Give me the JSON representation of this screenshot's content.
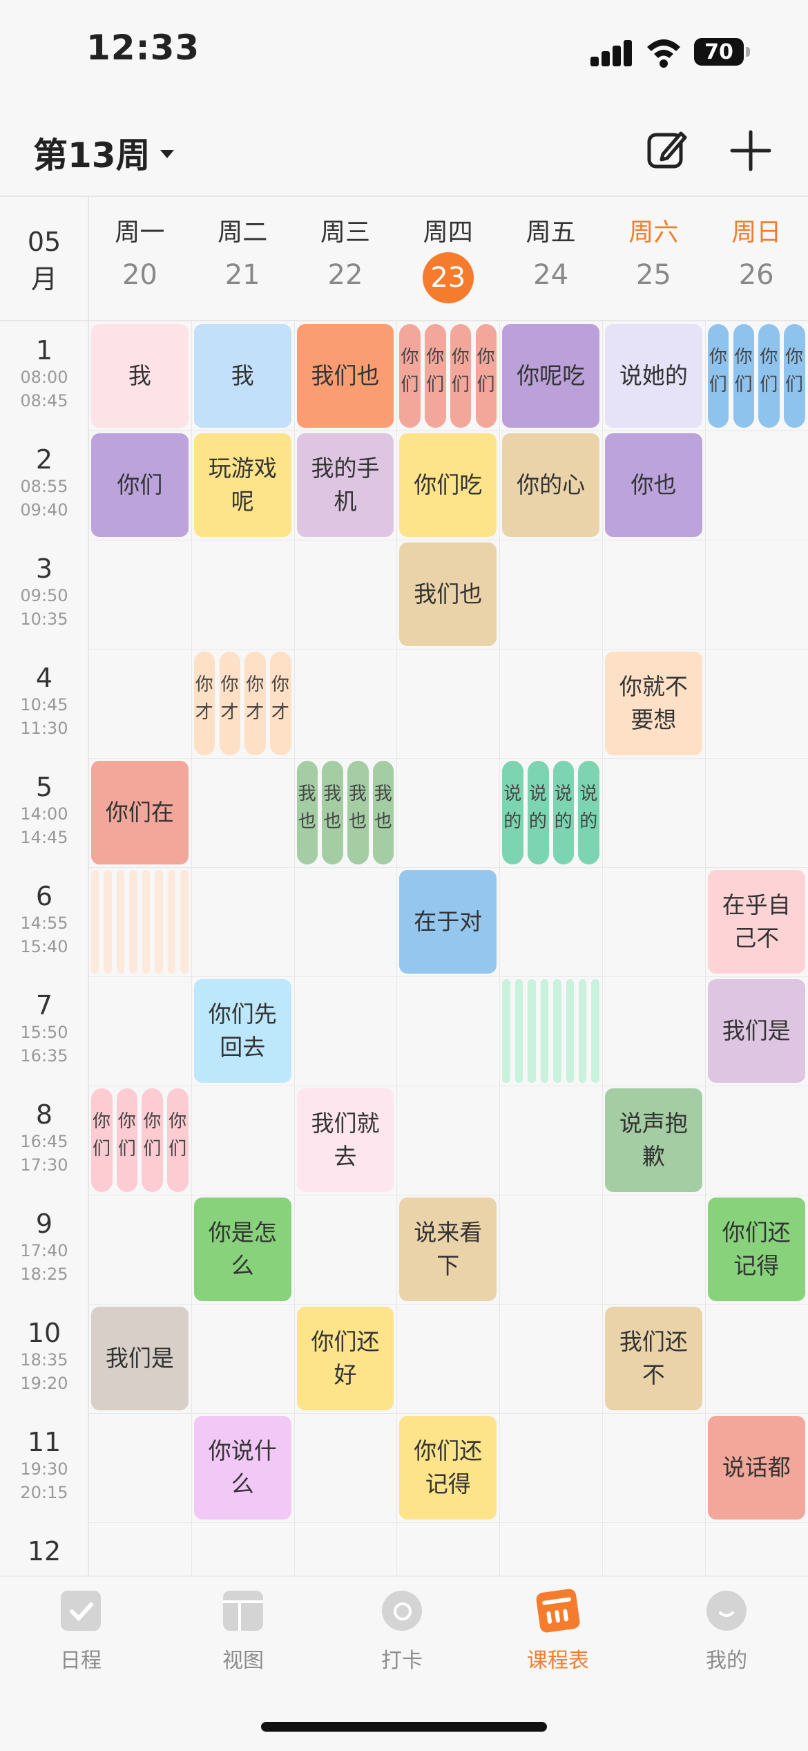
{
  "status": {
    "time": "12:33",
    "battery": "70"
  },
  "header": {
    "week_label": "第13周"
  },
  "month": {
    "line1": "05",
    "line2": "月"
  },
  "colors": {
    "accent": "#f47c2c"
  },
  "days": [
    {
      "name": "周一",
      "date": "20"
    },
    {
      "name": "周二",
      "date": "21"
    },
    {
      "name": "周三",
      "date": "22"
    },
    {
      "name": "周四",
      "date": "23",
      "today": true
    },
    {
      "name": "周五",
      "date": "24"
    },
    {
      "name": "周六",
      "date": "25",
      "weekend": true
    },
    {
      "name": "周日",
      "date": "26",
      "weekend": true
    }
  ],
  "periods": [
    {
      "n": "1",
      "start": "08:00",
      "end": "08:45"
    },
    {
      "n": "2",
      "start": "08:55",
      "end": "09:40"
    },
    {
      "n": "3",
      "start": "09:50",
      "end": "10:35"
    },
    {
      "n": "4",
      "start": "10:45",
      "end": "11:30"
    },
    {
      "n": "5",
      "start": "14:00",
      "end": "14:45"
    },
    {
      "n": "6",
      "start": "14:55",
      "end": "15:40"
    },
    {
      "n": "7",
      "start": "15:50",
      "end": "16:35"
    },
    {
      "n": "8",
      "start": "16:45",
      "end": "17:30"
    },
    {
      "n": "9",
      "start": "17:40",
      "end": "18:25"
    },
    {
      "n": "10",
      "start": "18:35",
      "end": "19:20"
    },
    {
      "n": "11",
      "start": "19:30",
      "end": "20:15"
    },
    {
      "n": "12",
      "start": "",
      "end": ""
    }
  ],
  "courses": [
    {
      "day": 0,
      "period": 0,
      "text": "我",
      "color": "#fde3e8"
    },
    {
      "day": 1,
      "period": 0,
      "text": "我",
      "color": "#c3e0fb"
    },
    {
      "day": 2,
      "period": 0,
      "text": "我们也",
      "color": "#fb9d72"
    },
    {
      "day": 4,
      "period": 0,
      "text": "你呢吃",
      "color": "#bba0da"
    },
    {
      "day": 5,
      "period": 0,
      "text": "说她的",
      "color": "#e6e2f8"
    },
    {
      "day": 0,
      "period": 1,
      "text": "你们",
      "color": "#bca3dc"
    },
    {
      "day": 1,
      "period": 1,
      "text": "玩游戏呢",
      "color": "#fde48a"
    },
    {
      "day": 2,
      "period": 1,
      "text": "我的手机",
      "color": "#dec6e3"
    },
    {
      "day": 3,
      "period": 1,
      "text": "你们吃",
      "color": "#fde48a"
    },
    {
      "day": 4,
      "period": 1,
      "text": "你的心",
      "color": "#ead3a9"
    },
    {
      "day": 5,
      "period": 1,
      "text": "你也",
      "color": "#bca3dc"
    },
    {
      "day": 3,
      "period": 2,
      "text": "我们也",
      "color": "#ead3a9"
    },
    {
      "day": 5,
      "period": 3,
      "text": "你就不要想",
      "color": "#fde0c6"
    },
    {
      "day": 0,
      "period": 4,
      "text": "你们在",
      "color": "#f2a79a"
    },
    {
      "day": 3,
      "period": 5,
      "text": "在于对",
      "color": "#95c7ee"
    },
    {
      "day": 6,
      "period": 5,
      "text": "在乎自己不",
      "color": "#fdd3d6"
    },
    {
      "day": 1,
      "period": 6,
      "text": "你们先回去",
      "color": "#bde7fb"
    },
    {
      "day": 6,
      "period": 6,
      "text": "我们是",
      "color": "#dec6e3"
    },
    {
      "day": 2,
      "period": 7,
      "text": "我们就去",
      "color": "#fde6ee"
    },
    {
      "day": 5,
      "period": 7,
      "text": "说声抱歉",
      "color": "#a4cda4"
    },
    {
      "day": 1,
      "period": 8,
      "text": "你是怎么",
      "color": "#88d27c"
    },
    {
      "day": 3,
      "period": 8,
      "text": "说来看下",
      "color": "#ead3a9"
    },
    {
      "day": 6,
      "period": 8,
      "text": "你们还记得",
      "color": "#88d27c"
    },
    {
      "day": 0,
      "period": 9,
      "text": "我们是",
      "color": "#d8d0c8"
    },
    {
      "day": 2,
      "period": 9,
      "text": "你们还好",
      "color": "#fde48a"
    },
    {
      "day": 5,
      "period": 9,
      "text": "我们还不",
      "color": "#ead3a9"
    },
    {
      "day": 1,
      "period": 10,
      "text": "你说什么",
      "color": "#f2c9f6"
    },
    {
      "day": 3,
      "period": 10,
      "text": "你们还记得",
      "color": "#fde48a"
    },
    {
      "day": 6,
      "period": 10,
      "text": "说话都",
      "color": "#f2a79a"
    }
  ],
  "strip_groups": [
    {
      "day": 3,
      "period": 0,
      "count": 4,
      "color": "#f2a79a",
      "c1": "你",
      "c2": "们"
    },
    {
      "day": 6,
      "period": 0,
      "count": 4,
      "color": "#8ec3ee",
      "c1": "你",
      "c2": "们"
    },
    {
      "day": 1,
      "period": 3,
      "count": 4,
      "color": "#fde0c6",
      "c1": "你",
      "c2": "才"
    },
    {
      "day": 2,
      "period": 4,
      "count": 4,
      "color": "#a4cda4",
      "c1": "我",
      "c2": "也"
    },
    {
      "day": 4,
      "period": 4,
      "count": 4,
      "color": "#7dd4b2",
      "c1": "说",
      "c2": "的"
    },
    {
      "day": 0,
      "period": 5,
      "count": 8,
      "color": "#fde9dc",
      "c1": "",
      "c2": ""
    },
    {
      "day": 4,
      "period": 6,
      "count": 8,
      "color": "#c8f1de",
      "c1": "",
      "c2": ""
    },
    {
      "day": 0,
      "period": 7,
      "count": 4,
      "color": "#fdccd2",
      "c1": "你",
      "c2": "们"
    }
  ],
  "tabs": [
    {
      "label": "日程",
      "icon": "checkbox-icon"
    },
    {
      "label": "视图",
      "icon": "layout-icon"
    },
    {
      "label": "打卡",
      "icon": "checkin-icon"
    },
    {
      "label": "课程表",
      "icon": "timetable-icon",
      "active": true
    },
    {
      "label": "我的",
      "icon": "profile-icon"
    }
  ]
}
